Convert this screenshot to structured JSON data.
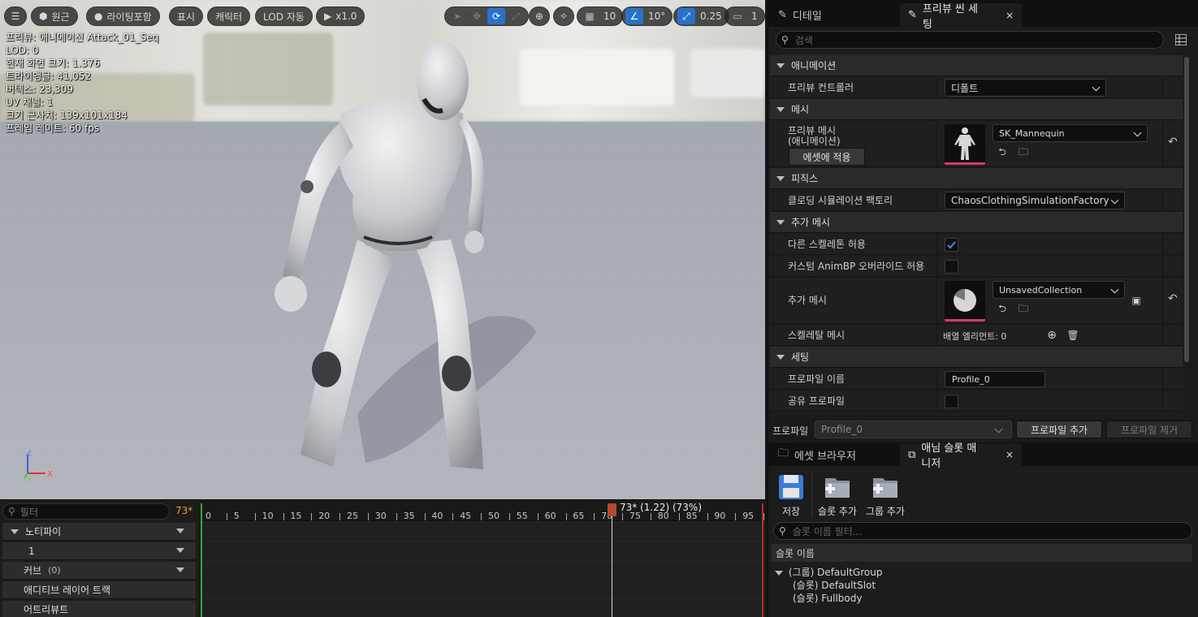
{
  "viewport": {
    "toolbar": {
      "perspective": "원근",
      "lighting": "라이팅포함",
      "show": "표시",
      "character": "캐릭터",
      "lod": "LOD 자동",
      "play_speed": "x1.0",
      "grid_snap": "10",
      "rotation_snap": "10°",
      "scale_snap": "0.25",
      "camera_speed": "1"
    },
    "stats": [
      "프리뷰: 애니메이션 Attack_01_Seq",
      "LOD: 0",
      "현재 화면 크기: 1.376",
      "트라이앵글: 41,052",
      "버텍스: 23,309",
      "UV 채널: 1",
      "크기 근사치: 139x101x184",
      "프레임 레이트: 60 fps"
    ],
    "axis": {
      "z": "Z",
      "x": "X",
      "y": "Y"
    }
  },
  "timeline": {
    "filter_placeholder": "필터",
    "frame_count": "73*",
    "tracks": [
      {
        "label": "노티파이",
        "sub": "",
        "caret": true
      },
      {
        "label": "1",
        "sub": "",
        "caret": true
      },
      {
        "label": "커브",
        "sub": "(0)",
        "caret": true
      },
      {
        "label": "애디티브 레이어 트랙",
        "sub": "",
        "caret": false
      },
      {
        "label": "어트리뷰트",
        "sub": "",
        "caret": false
      }
    ],
    "ticks": [
      "0",
      "5",
      "10",
      "15",
      "20",
      "25",
      "30",
      "35",
      "40",
      "45",
      "50",
      "55",
      "60",
      "65",
      "70",
      "75",
      "80",
      "85",
      "90",
      "95"
    ],
    "playhead_label": "73* (1.22) (73%)",
    "playhead_frame": 73
  },
  "details": {
    "tabs": {
      "details": "디테일",
      "preview_settings": "프리뷰 씬 세팅",
      "close": "×"
    },
    "search_placeholder": "검색",
    "categories": {
      "animation": "애니메이션",
      "mesh": "메시",
      "physics": "피직스",
      "additional_mesh": "추가 메시",
      "settings": "세팅"
    },
    "rows": {
      "preview_controller": {
        "name": "프리뷰 컨트롤러",
        "value": "디폴트"
      },
      "preview_mesh": {
        "name1": "프리뷰 메시",
        "name2": "(애니메이션)",
        "apply": "에셋에 적용",
        "value": "SK_Mannequin"
      },
      "clothing": {
        "name": "클로딩 시뮬레이션 팩토리",
        "value": "ChaosClothingSimulationFactory"
      },
      "allow_diff_skel": {
        "name": "다른 스켈레톤 허용",
        "checked": true
      },
      "custom_animbp": {
        "name": "커스텀 AnimBP 오버라이드 허용",
        "checked": false
      },
      "additional_mesh": {
        "name": "추가 메시",
        "value": "UnsavedCollection"
      },
      "skeletal_meshes": {
        "name": "스켈레탈 메시",
        "value": "배열 엘리먼트: 0"
      },
      "profile_name": {
        "name": "프로파일 이름",
        "value": "Profile_0"
      },
      "shared_profile": {
        "name": "공유 프로파일",
        "checked": false
      }
    },
    "profile": {
      "label": "프로파일",
      "value": "Profile_0",
      "add": "프로파일 추가",
      "remove": "프로파일 제거"
    }
  },
  "slots": {
    "tabs": {
      "asset_browser": "에셋 브라우저",
      "slot_manager": "애님 슬롯 매니저",
      "close": "×"
    },
    "buttons": {
      "save": "저장",
      "add_slot": "슬롯 추가",
      "add_group": "그룹 추가"
    },
    "filter_placeholder": "슬롯 이름 필터...",
    "header": "슬롯 이름",
    "group": "(그룹) DefaultGroup",
    "items": [
      "(슬롯) DefaultSlot",
      "(슬롯) Fullbody"
    ]
  },
  "colors": {
    "accent": "#2873c9",
    "playhead": "#b8472c",
    "frame_count": "#f09b2e",
    "thumb_bar": "#d2367b"
  }
}
